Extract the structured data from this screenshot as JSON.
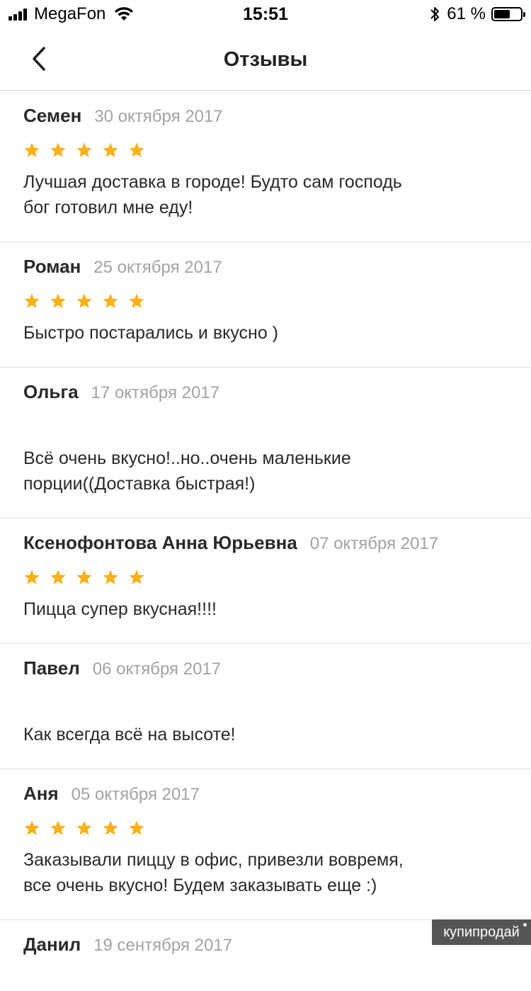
{
  "status_bar": {
    "carrier": "MegaFon",
    "time": "15:51",
    "battery_percent": "61 %",
    "battery_level": 0.61
  },
  "nav": {
    "title": "Отзывы",
    "back_icon": "chevron-left-icon"
  },
  "colors": {
    "star": "#f7b11a",
    "date": "#a3a3a3",
    "divider": "#e3e3e3"
  },
  "reviews": [
    {
      "name": "Семен",
      "date": "30 октября 2017",
      "rating": 5,
      "text": "Лучшая доставка в городе! Будто сам господь\nбог готовил мне еду!"
    },
    {
      "name": "Роман",
      "date": "25 октября 2017",
      "rating": 5,
      "text": "Быстро постарались и вкусно )"
    },
    {
      "name": "Ольга",
      "date": "17 октября 2017",
      "rating": 0,
      "text": "Всё очень вкусно!..но..очень маленькие\nпорции((Доставка быстрая!)"
    },
    {
      "name": "Ксенофонтова Анна Юрьевна",
      "date": "07 октября 2017",
      "rating": 5,
      "text": "Пицца супер вкусная!!!!"
    },
    {
      "name": "Павел",
      "date": "06 октября 2017",
      "rating": 0,
      "text": "Как всегда всё на высоте!"
    },
    {
      "name": "Аня",
      "date": "05 октября 2017",
      "rating": 5,
      "text": "Заказывали пиццу в офис, привезли вовремя,\nвсе очень вкусно! Будем заказывать еще :)"
    },
    {
      "name": "Данил",
      "date": "19 сентября 2017",
      "rating": 0,
      "text": ""
    }
  ],
  "watermark": "купипродай"
}
